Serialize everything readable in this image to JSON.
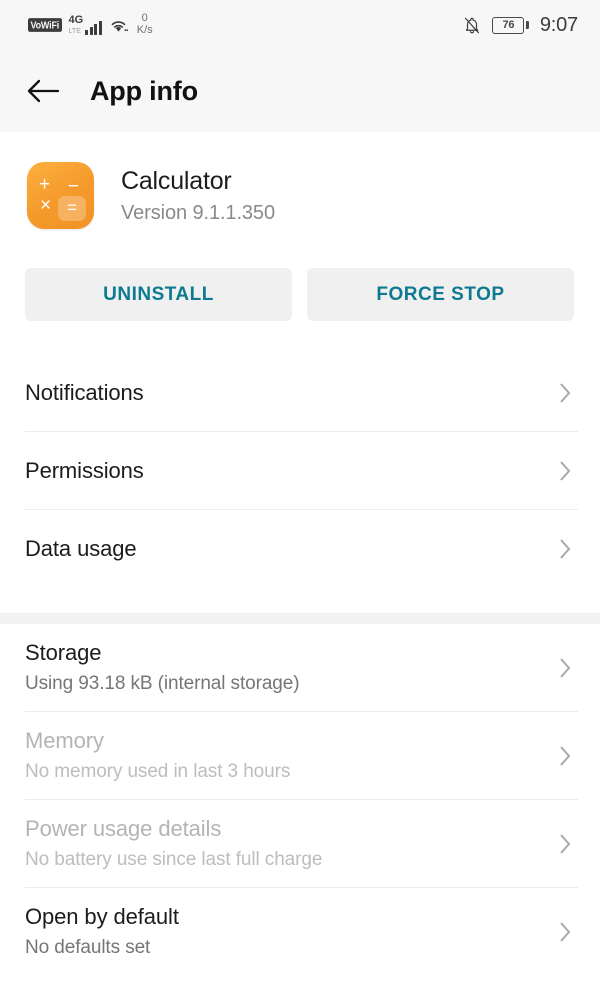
{
  "status_bar": {
    "vowifi_badge": "VoWiFi",
    "network_type": "4G",
    "network_sub": "LTE",
    "wifi_icon": "wifi-icon",
    "data_rate_value": "0",
    "data_rate_unit": "K/s",
    "silent_icon": "bell-off-icon",
    "battery_level": "76",
    "time": "9:07"
  },
  "app_bar": {
    "back_icon": "back-arrow-icon",
    "title": "App info"
  },
  "app_identity": {
    "icon_name": "calculator-app-icon",
    "icon_color": "#f5992b",
    "icon_symbols": {
      "plus": "+",
      "minus": "−",
      "times": "×",
      "equals": "="
    },
    "name": "Calculator",
    "version": "Version 9.1.1.350"
  },
  "actions": {
    "accent_color": "#0d7a91",
    "uninstall_label": "UNINSTALL",
    "force_stop_label": "FORCE STOP"
  },
  "groups": [
    {
      "rows": [
        {
          "title": "Notifications",
          "subtitle": "",
          "disabled": false
        },
        {
          "title": "Permissions",
          "subtitle": "",
          "disabled": false
        },
        {
          "title": "Data usage",
          "subtitle": "",
          "disabled": false
        }
      ]
    },
    {
      "rows": [
        {
          "title": "Storage",
          "subtitle": "Using 93.18 kB (internal storage)",
          "disabled": false
        },
        {
          "title": "Memory",
          "subtitle": "No memory used in last 3 hours",
          "disabled": true
        },
        {
          "title": "Power usage details",
          "subtitle": "No battery use since last full charge",
          "disabled": true
        },
        {
          "title": "Open by default",
          "subtitle": "No defaults set",
          "disabled": false
        }
      ]
    }
  ]
}
